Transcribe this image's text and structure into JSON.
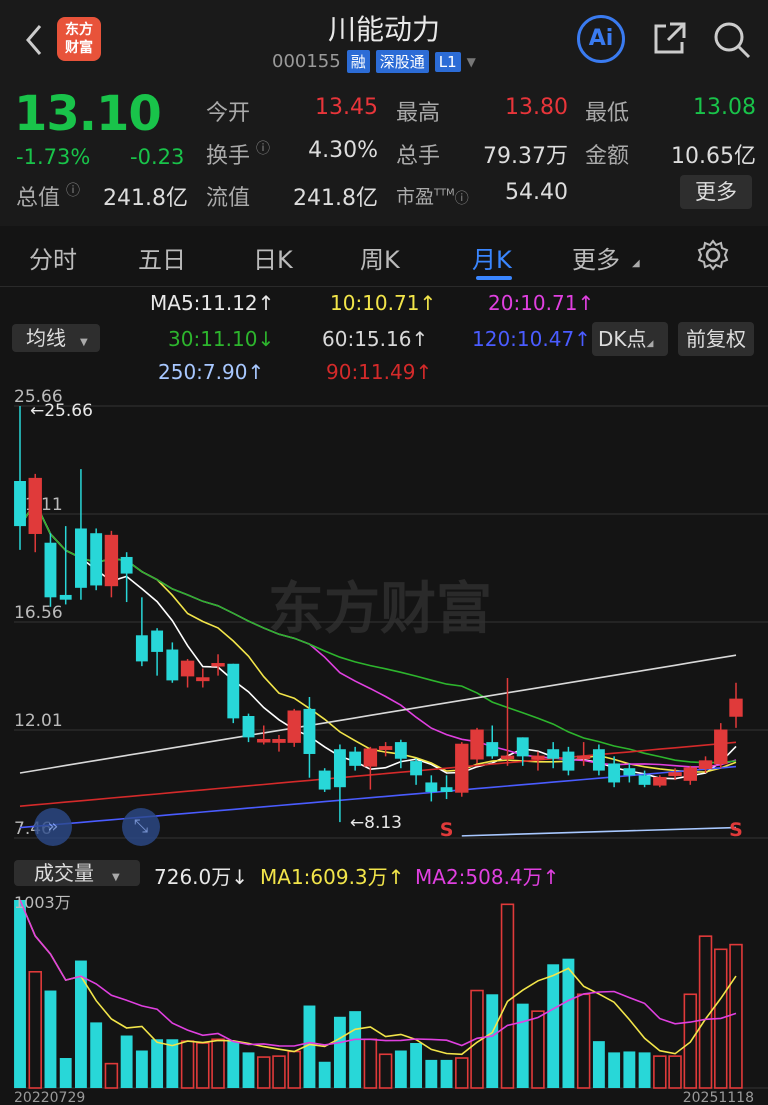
{
  "header": {
    "back_icon": "chevron-left-icon",
    "logo_text": "东方财富",
    "title": "川能动力",
    "code": "000155",
    "tags": [
      "融",
      "深股通",
      "L1"
    ],
    "ai_label": "Ai"
  },
  "quote": {
    "price": "13.10",
    "change_pct": "-1.73%",
    "change": "-0.23",
    "open_label": "今开",
    "open": "13.45",
    "high_label": "最高",
    "high": "13.80",
    "low_label": "最低",
    "low": "13.08",
    "turnover_label": "换手",
    "turnover": "4.30%",
    "volume_label": "总手",
    "volume": "79.37万",
    "amount_label": "金额",
    "amount": "10.65亿",
    "mcap_label": "总值",
    "mcap": "241.8亿",
    "float_label": "流值",
    "float": "241.8亿",
    "pe_label": "市盈",
    "pe_sup": "TTM",
    "pe": "54.40",
    "more_label": "更多"
  },
  "tabs": [
    "分时",
    "五日",
    "日K",
    "周K",
    "月K",
    "更多"
  ],
  "active_tab": 4,
  "ma_legend": {
    "ma5": "MA5:11.12↑",
    "ma10": "10:10.71↑",
    "ma20": "20:10.71↑",
    "ma30": "30:11.10↓",
    "ma60": "60:15.16↑",
    "ma120": "120:10.47↑",
    "ma250": "250:7.90↑",
    "ma90": "90:11.49↑",
    "select_label": "均线",
    "dk_label": "DK点",
    "adjust_label": "前复权"
  },
  "chart_data": {
    "type": "candlestick",
    "y_ticks": [
      "25.66",
      "21.11",
      "16.56",
      "12.01",
      "7.46"
    ],
    "max_label": "←25.66",
    "min_label": "←8.13",
    "signals": [
      "S",
      "S"
    ],
    "watermark": "东方财富",
    "candles": [
      [
        22.5,
        20.6,
        25.66,
        19.6
      ],
      [
        20.3,
        22.6,
        22.8,
        19.5
      ],
      [
        19.9,
        17.6,
        20.3,
        17.2
      ],
      [
        17.7,
        17.5,
        20.6,
        17.3
      ],
      [
        20.5,
        18.0,
        23.0,
        17.5
      ],
      [
        20.3,
        18.1,
        20.5,
        17.9
      ],
      [
        18.1,
        20.2,
        20.4,
        17.6
      ],
      [
        19.3,
        18.6,
        19.5,
        17.4
      ],
      [
        16.0,
        14.9,
        17.6,
        14.7
      ],
      [
        16.2,
        15.3,
        16.3,
        14.3
      ],
      [
        15.4,
        14.1,
        15.7,
        14.0
      ],
      [
        14.3,
        14.9,
        15.0,
        13.8
      ],
      [
        14.1,
        14.2,
        14.6,
        13.8
      ],
      [
        14.8,
        14.8,
        15.2,
        14.3
      ],
      [
        14.8,
        12.5,
        14.8,
        12.3
      ],
      [
        12.6,
        11.7,
        12.7,
        11.5
      ],
      [
        11.6,
        11.6,
        12.2,
        11.4
      ],
      [
        11.5,
        11.6,
        11.8,
        11.1
      ],
      [
        11.5,
        12.8,
        12.9,
        11.3
      ],
      [
        12.9,
        11.0,
        13.4,
        10.0
      ],
      [
        10.3,
        9.5,
        10.4,
        9.4
      ],
      [
        11.2,
        9.6,
        11.4,
        8.13
      ],
      [
        11.1,
        10.5,
        11.3,
        10.3
      ],
      [
        10.5,
        11.2,
        11.3,
        9.5
      ],
      [
        11.2,
        11.3,
        11.5,
        10.9
      ],
      [
        11.5,
        10.8,
        11.6,
        10.4
      ],
      [
        10.7,
        10.1,
        10.8,
        9.7
      ],
      [
        9.8,
        9.4,
        10.1,
        9.0
      ],
      [
        9.6,
        9.4,
        10.1,
        9.1
      ],
      [
        9.4,
        11.4,
        11.5,
        9.2
      ],
      [
        10.8,
        12.0,
        12.1,
        10.6
      ],
      [
        11.5,
        10.9,
        12.2,
        10.8
      ],
      [
        10.9,
        10.9,
        14.2,
        10.5
      ],
      [
        11.7,
        10.9,
        11.7,
        10.5
      ],
      [
        10.8,
        10.9,
        11.1,
        10.3
      ],
      [
        11.2,
        10.8,
        11.5,
        10.4
      ],
      [
        11.1,
        10.3,
        11.3,
        10.1
      ],
      [
        10.9,
        10.9,
        11.5,
        10.5
      ],
      [
        11.2,
        10.3,
        11.4,
        10.1
      ],
      [
        10.6,
        9.8,
        10.9,
        9.6
      ],
      [
        10.4,
        10.1,
        10.6,
        9.8
      ],
      [
        10.1,
        9.7,
        10.3,
        9.6
      ],
      [
        9.7,
        10.0,
        10.1,
        9.6
      ],
      [
        10.1,
        10.2,
        10.4,
        9.9
      ],
      [
        9.9,
        10.4,
        10.5,
        9.7
      ],
      [
        10.4,
        10.7,
        10.9,
        10.2
      ],
      [
        10.6,
        12.0,
        12.3,
        10.4
      ],
      [
        12.6,
        13.3,
        14.0,
        12.1
      ]
    ]
  },
  "volume_legend": {
    "select_label": "成交量",
    "vol": "726.0万↓",
    "ma1": "MA1:609.3万↑",
    "ma2": "MA2:508.4万↑",
    "max_label": "1003万"
  },
  "volume_data": [
    1003,
    620,
    520,
    160,
    680,
    350,
    130,
    280,
    200,
    260,
    260,
    250,
    240,
    260,
    250,
    190,
    165,
    170,
    195,
    440,
    140,
    380,
    410,
    260,
    180,
    200,
    240,
    150,
    150,
    160,
    520,
    500,
    980,
    450,
    410,
    660,
    690,
    500,
    250,
    190,
    195,
    190,
    170,
    170,
    500,
    810,
    740,
    765
  ],
  "dates": {
    "start": "20220729",
    "end": "20251118"
  },
  "colors": {
    "up": "#e03a3a",
    "down": "#28d7d8",
    "ma5": "#ffffff",
    "ma10": "#f2e54a",
    "ma20": "#e040e0",
    "ma30": "#2db52d",
    "ma60": "#d9d9d9",
    "ma120": "#4a5cff",
    "ma250": "#a8c8ff",
    "ma90": "#d42a2a"
  }
}
